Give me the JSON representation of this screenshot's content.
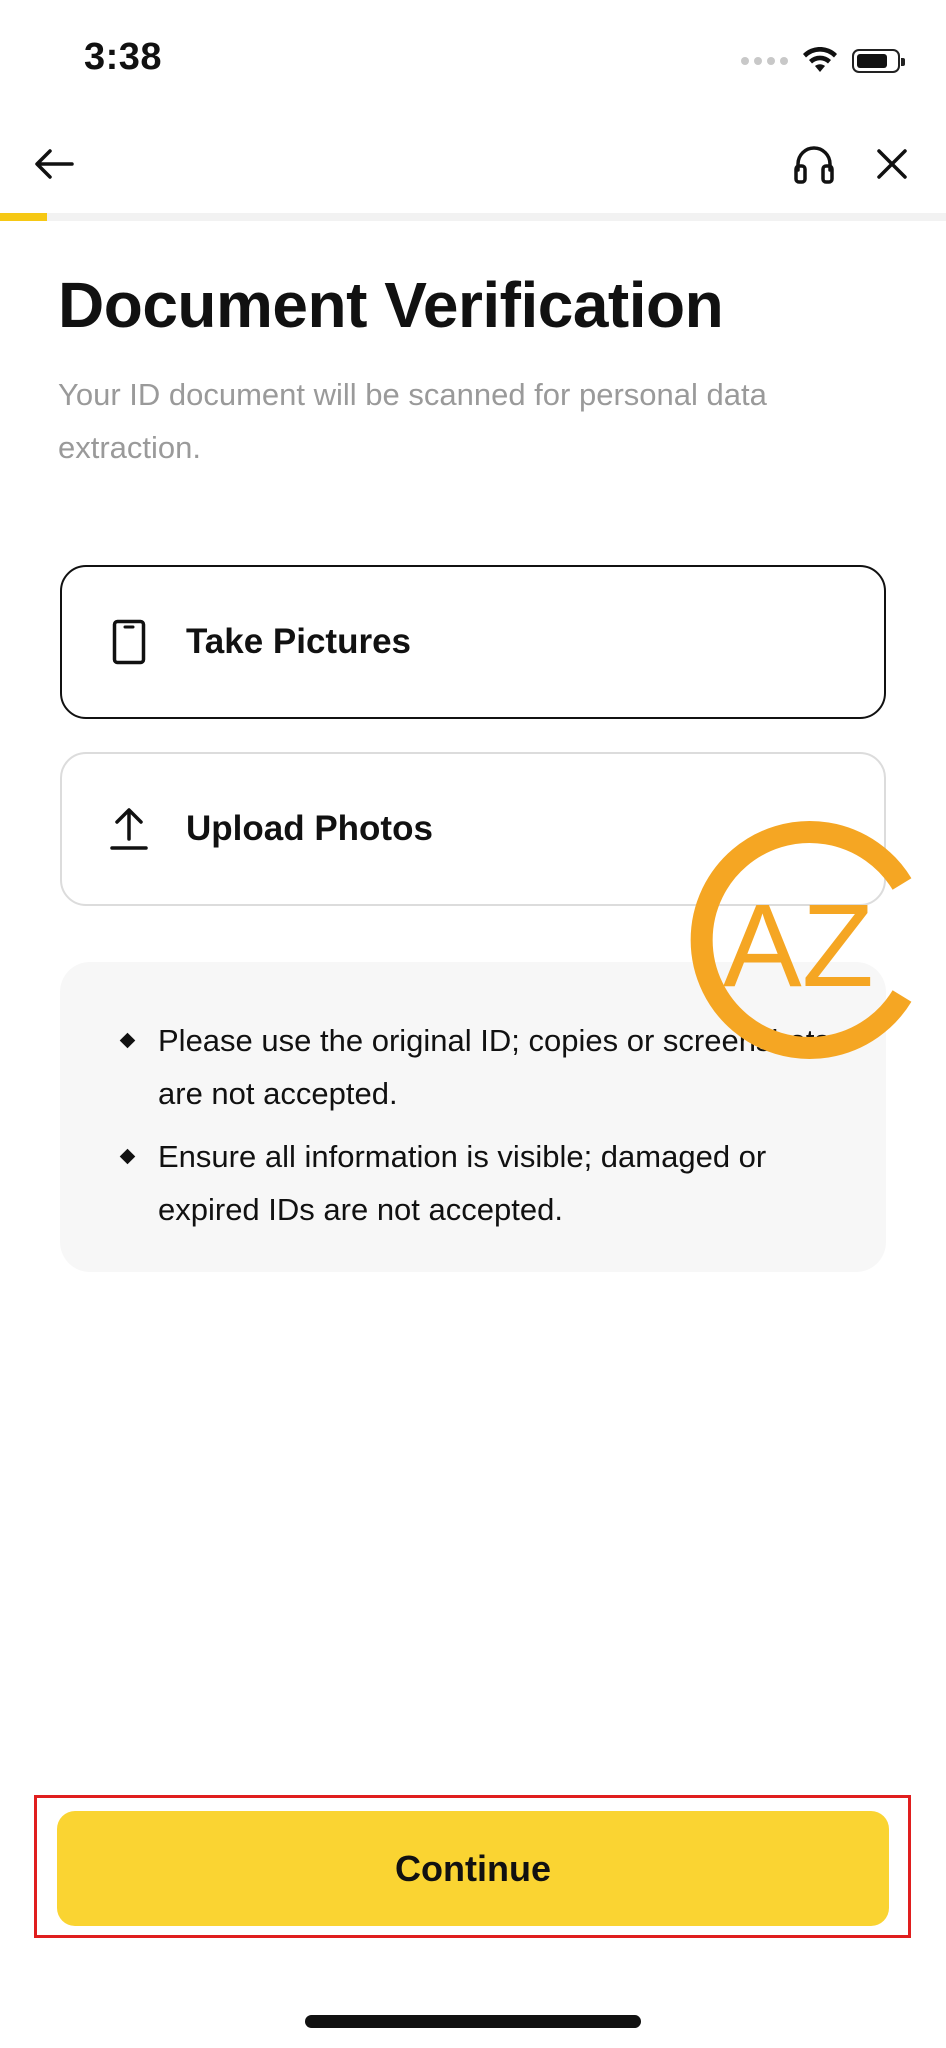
{
  "status_bar": {
    "time": "3:38"
  },
  "nav": {
    "back_icon": "arrow-left-icon",
    "support_icon": "headset-icon",
    "close_icon": "close-icon",
    "progress_fraction": 0.05,
    "progress_color": "#f6c814"
  },
  "page": {
    "title": "Document Verification",
    "subtitle": "Your ID document will be scanned for personal data extraction."
  },
  "options": [
    {
      "label": "Take Pictures",
      "icon": "phone-icon",
      "selected": true
    },
    {
      "label": "Upload Photos",
      "icon": "upload-icon",
      "selected": false
    }
  ],
  "info": {
    "items": [
      "Please use the original ID; copies or screenshots are not accepted.",
      "Ensure all information is visible; damaged or expired IDs are not accepted."
    ]
  },
  "watermark": {
    "text": "AZ",
    "color": "#f5a623"
  },
  "footer": {
    "continue_label": "Continue",
    "button_color": "#fad432",
    "highlight_color": "#e01e1e"
  }
}
